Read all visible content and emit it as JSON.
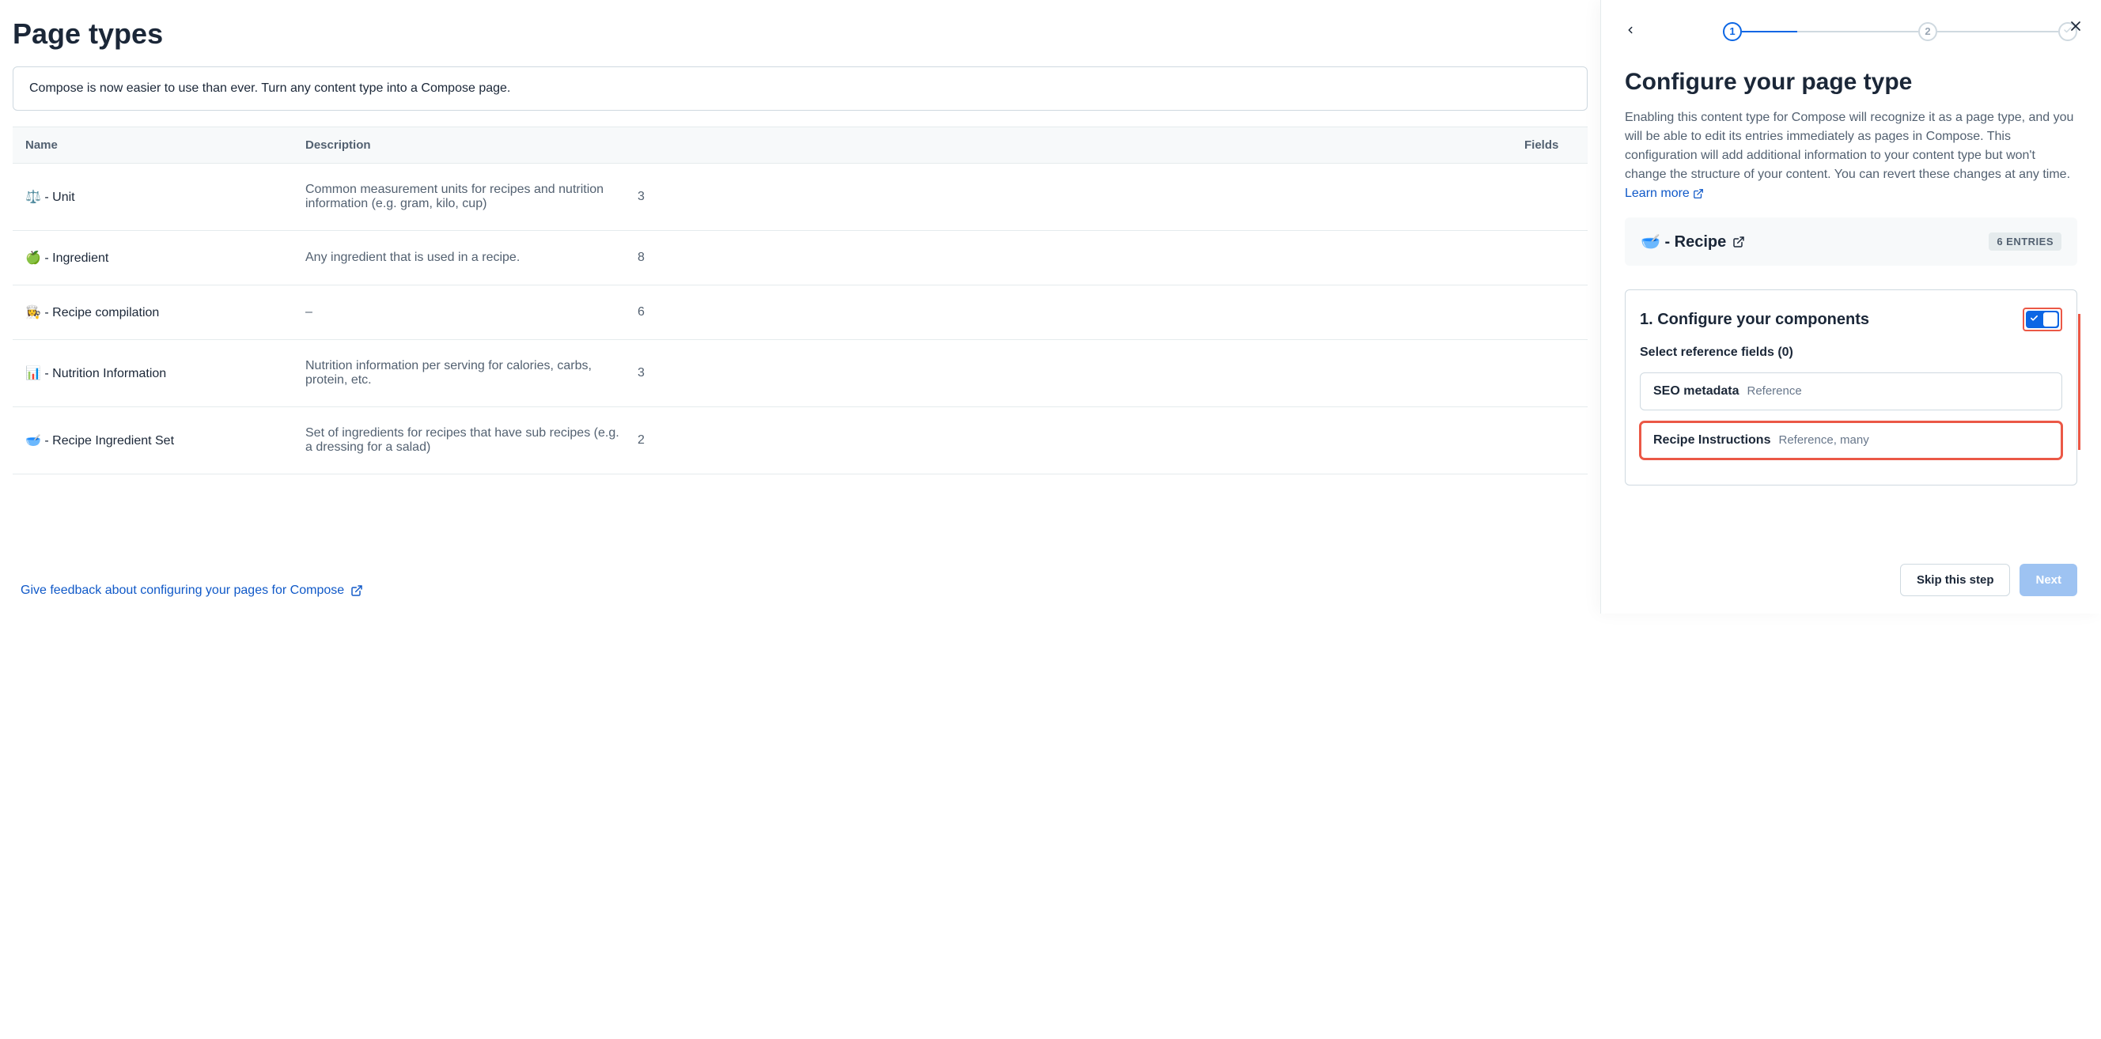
{
  "main": {
    "title": "Page types",
    "banner": "Compose is now easier to use than ever. Turn any content type into a Compose page.",
    "columns": {
      "name": "Name",
      "description": "Description",
      "fields": "Fields"
    },
    "rows": [
      {
        "name": "⚖️ - Unit",
        "description": "Common measurement units for recipes and nutrition information (e.g. gram, kilo, cup)",
        "fields": "3"
      },
      {
        "name": "🍏 - Ingredient",
        "description": "Any ingredient that is used in a recipe.",
        "fields": "8"
      },
      {
        "name": "👩‍🍳 - Recipe compilation",
        "description": "–",
        "fields": "6"
      },
      {
        "name": "📊 - Nutrition Information",
        "description": "Nutrition information per serving for calories, carbs, protein, etc.",
        "fields": "3"
      },
      {
        "name": "🥣 - Recipe Ingredient Set",
        "description": "Set of ingredients for recipes that have sub recipes (e.g. a dressing for a salad)",
        "fields": "2"
      }
    ],
    "feedback": "Give feedback about configuring your pages for Compose"
  },
  "panel": {
    "steps": {
      "s1": "1",
      "s2": "2"
    },
    "title": "Configure your page type",
    "description": "Enabling this content type for Compose will recognize it as a page type, and you will be able to edit its entries immediately as pages in Compose. This configuration will add additional information to your content type but won't change the structure of your content. You can revert these changes at any time.",
    "learnMore": "Learn more",
    "recipe": {
      "name": "🥣 - Recipe",
      "entries": "6 ENTRIES"
    },
    "config": {
      "title": "1. Configure your components",
      "selectLabel": "Select reference fields (0)",
      "fields": [
        {
          "name": "SEO metadata",
          "type": "Reference"
        },
        {
          "name": "Recipe Instructions",
          "type": "Reference, many"
        }
      ]
    },
    "footer": {
      "skip": "Skip this step",
      "next": "Next"
    }
  }
}
